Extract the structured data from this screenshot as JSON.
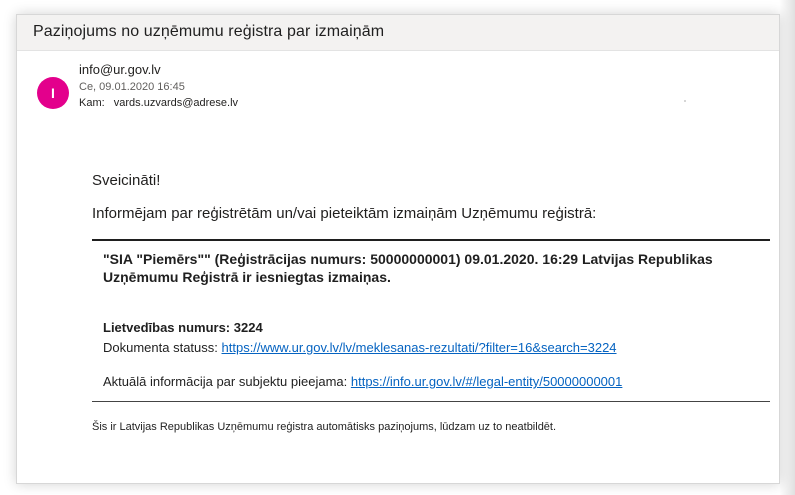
{
  "email": {
    "subject": "Paziņojums no uzņēmumu reģistra par izmaiņām",
    "avatar_initial": "I",
    "sender": "info@ur.gov.lv",
    "date": "Ce, 09.01.2020 16:45",
    "to_label": "Kam:",
    "to_value": "vards.uzvards@adrese.lv",
    "greeting": "Sveicināti!",
    "intro": "Informējam par reģistrētām un/vai pieteiktām izmaiņām Uzņēmumu reģistrā:",
    "registration_text": "\"SIA \"Piemērs\"\" (Reģistrācijas numurs: 50000000001) 09.01.2020. 16:29 Latvijas Republikas Uzņēmumu Reģistrā ir iesniegtas izmaiņas.",
    "lietvedibas": "Lietvedības numurs: 3224",
    "doc_status_label": "Dokumenta statuss:",
    "doc_status_link": "https://www.ur.gov.lv/lv/meklesanas-rezultati/?filter=16&search=3224",
    "actual_info_label": "Aktuālā informācija par subjektu pieejama:",
    "actual_info_link": "https://info.ur.gov.lv/#/legal-entity/50000000001",
    "footer": "Šis ir Latvijas Republikas Uzņēmumu reģistra automātisks paziņojums, lūdzam uz to neatbildēt."
  },
  "colors": {
    "avatar_bg": "#e3008c",
    "link": "#0563c1"
  }
}
